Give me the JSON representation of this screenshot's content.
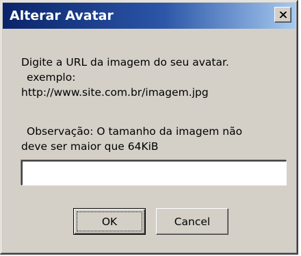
{
  "window": {
    "title": "Alterar Avatar",
    "close_icon": "close-x-icon"
  },
  "message": {
    "line1": "Digite a URL da imagem do seu avatar.",
    "line2": "exemplo:",
    "line3": "http://www.site.com.br/imagem.jpg",
    "line4": "Observação: O tamanho da imagem não",
    "line5": "deve ser maior que 64KiB"
  },
  "url_input": {
    "value": "",
    "placeholder": ""
  },
  "buttons": {
    "ok_label": "OK",
    "cancel_label": "Cancel"
  },
  "colors": {
    "titlebar_start": "#0a246a",
    "titlebar_end": "#a6caf0",
    "face": "#d4d0c8"
  }
}
